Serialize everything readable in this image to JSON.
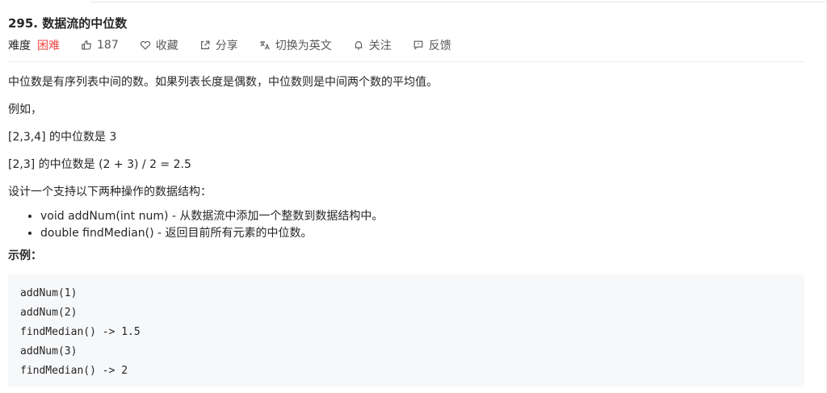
{
  "problem": {
    "title": "295. 数据流的中位数",
    "difficulty_label": "难度",
    "difficulty_value": "困难",
    "likes": "187",
    "favorite_label": "收藏",
    "share_label": "分享",
    "switch_lang_label": "切换为英文",
    "follow_label": "关注",
    "feedback_label": "反馈"
  },
  "description": {
    "p1": "中位数是有序列表中间的数。如果列表长度是偶数，中位数则是中间两个数的平均值。",
    "p2": "例如，",
    "p3": "[2,3,4] 的中位数是 3",
    "p4": "[2,3] 的中位数是 (2 + 3) / 2 = 2.5",
    "p5": "设计一个支持以下两种操作的数据结构：",
    "ops": [
      "void addNum(int num) - 从数据流中添加一个整数到数据结构中。",
      "double findMedian() - 返回目前所有元素的中位数。"
    ],
    "example_title": "示例：",
    "example_code": [
      "addNum(1)",
      "addNum(2)",
      "findMedian() -> 1.5",
      "addNum(3)",
      "findMedian() -> 2"
    ]
  },
  "colors": {
    "difficulty_hard": "#ef4743",
    "code_bg": "#f7f8fa"
  },
  "icons": [
    "thumbs-up-icon",
    "heart-icon",
    "share-icon",
    "translate-icon",
    "bell-icon",
    "feedback-icon"
  ]
}
